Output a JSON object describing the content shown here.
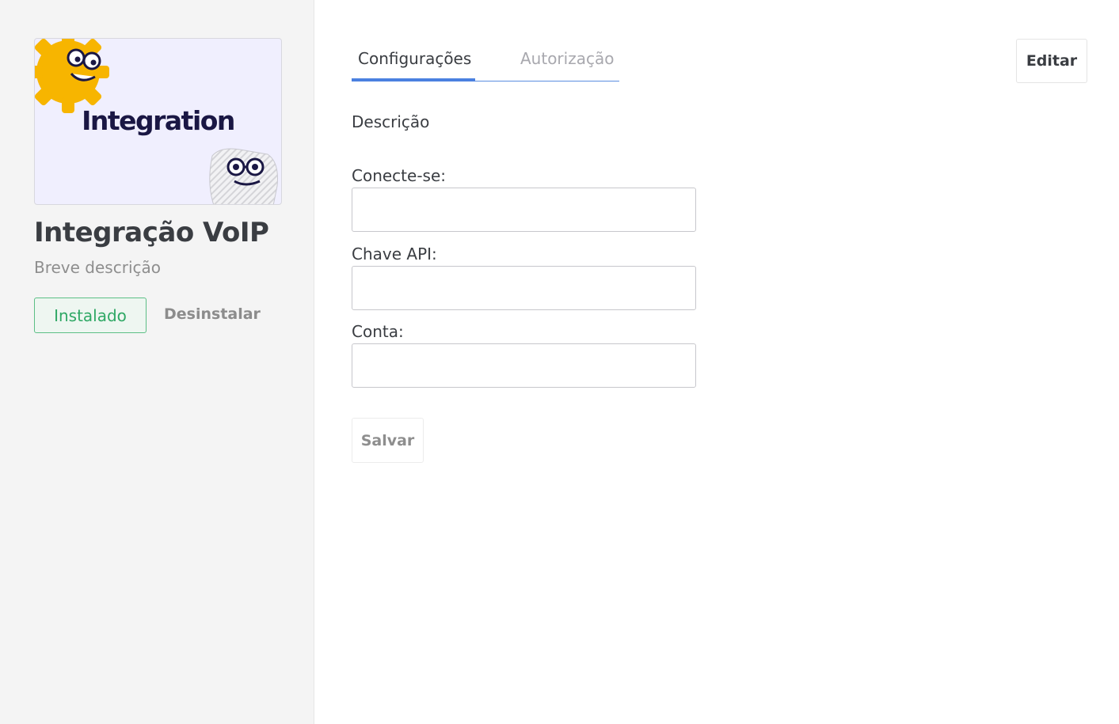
{
  "sidebar": {
    "banner": {
      "title": "Integration",
      "mascots": [
        "gear-mascot-icon",
        "paper-mascot-icon"
      ],
      "background_color": "#f0effe",
      "gear_color": "#f7b500"
    },
    "app_title": "Integração VoIP",
    "app_description": "Breve descrição",
    "installed_label": "Instalado",
    "uninstall_label": "Desinstalar"
  },
  "main": {
    "tabs": [
      {
        "label": "Configurações",
        "active": true
      },
      {
        "label": "Autorização",
        "active": false
      }
    ],
    "edit_label": "Editar",
    "section_label": "Descrição",
    "fields": [
      {
        "label": "Conecte-se:",
        "value": "",
        "placeholder": ""
      },
      {
        "label": "Chave API:",
        "value": "",
        "placeholder": ""
      },
      {
        "label": "Conta:",
        "value": "",
        "placeholder": ""
      }
    ],
    "save_label": "Salvar"
  },
  "colors": {
    "accent_blue": "#4b80e0",
    "installed_green": "#2fa865",
    "sidebar_bg": "#f4f4f4"
  }
}
